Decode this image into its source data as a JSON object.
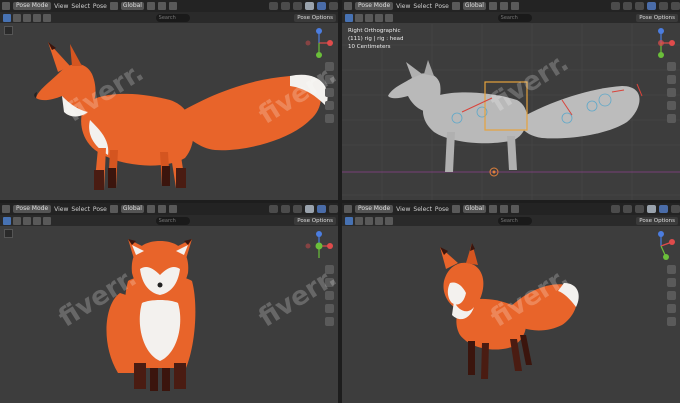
{
  "header": {
    "mode_label": "Pose Mode",
    "menu_view": "View",
    "menu_select": "Select",
    "menu_pose": "Pose",
    "orientation": "Global",
    "pose_options": "Pose Options",
    "search_placeholder": "Search"
  },
  "viewports": [
    {
      "name": "top-left"
    },
    {
      "name": "top-right",
      "info": {
        "line1": "Right Orthographic",
        "line2": "(111) rig | rig : head",
        "line3": "10 Centimeters"
      }
    },
    {
      "name": "bottom-left"
    },
    {
      "name": "bottom-right"
    }
  ],
  "watermark": "fiverr.",
  "colors": {
    "viewport_bg": "#3d3d3d",
    "header_bg": "#232323",
    "fox_orange": "#e8642a",
    "fox_white": "#f3f1ee",
    "fox_dark": "#4a1c12",
    "wire_grey": "#b9b9b9",
    "bone_highlight": "#e6a23c",
    "axis_x": "#e04b4b",
    "axis_y": "#6bbf3a",
    "axis_z": "#4b7de0"
  },
  "icons": [
    "cursor-icon",
    "eye-icon",
    "camera-icon",
    "hand-icon",
    "grid-icon",
    "search-icon"
  ]
}
